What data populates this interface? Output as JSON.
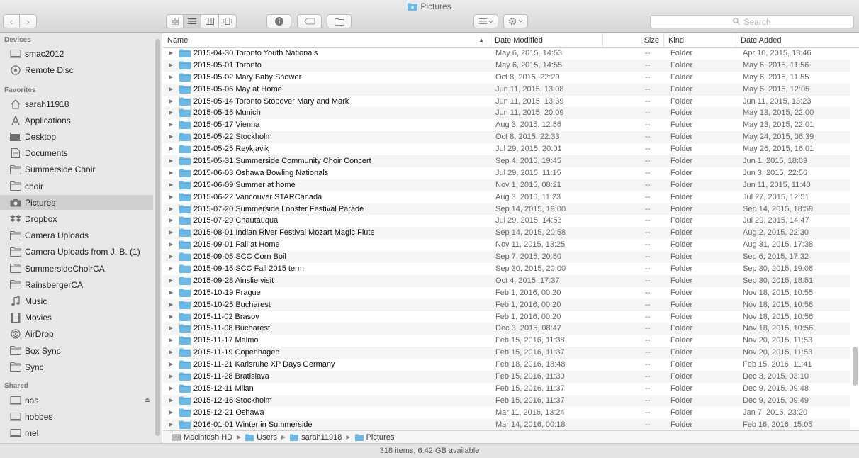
{
  "window": {
    "title": "Pictures"
  },
  "toolbar": {
    "search_placeholder": "Search"
  },
  "sidebar": {
    "devices_heading": "Devices",
    "devices": [
      {
        "label": "smac2012",
        "icon": "computer-icon"
      },
      {
        "label": "Remote Disc",
        "icon": "disc-icon"
      }
    ],
    "favorites_heading": "Favorites",
    "favorites": [
      {
        "label": "sarah11918",
        "icon": "home-icon"
      },
      {
        "label": "Applications",
        "icon": "applications-icon"
      },
      {
        "label": "Desktop",
        "icon": "desktop-icon"
      },
      {
        "label": "Documents",
        "icon": "document-icon"
      },
      {
        "label": "Summerside Choir",
        "icon": "folder-icon"
      },
      {
        "label": "choir",
        "icon": "folder-icon"
      },
      {
        "label": "Pictures",
        "icon": "camera-icon"
      },
      {
        "label": "Dropbox",
        "icon": "dropbox-icon"
      },
      {
        "label": "Camera Uploads",
        "icon": "folder-icon"
      },
      {
        "label": "Camera Uploads from J. B. (1)",
        "icon": "folder-icon"
      },
      {
        "label": "SummersideChoirCA",
        "icon": "folder-icon"
      },
      {
        "label": "RainsbergerCA",
        "icon": "folder-icon"
      },
      {
        "label": "Music",
        "icon": "music-icon"
      },
      {
        "label": "Movies",
        "icon": "movies-icon"
      },
      {
        "label": "AirDrop",
        "icon": "airdrop-icon"
      },
      {
        "label": "Box Sync",
        "icon": "folder-icon"
      },
      {
        "label": "Sync",
        "icon": "folder-icon"
      }
    ],
    "shared_heading": "Shared",
    "shared": [
      {
        "label": "nas",
        "icon": "server-icon"
      },
      {
        "label": "hobbes",
        "icon": "server-icon"
      },
      {
        "label": "mel",
        "icon": "server-icon"
      }
    ]
  },
  "columns": {
    "name": "Name",
    "date_modified": "Date Modified",
    "size": "Size",
    "kind": "Kind",
    "date_added": "Date Added"
  },
  "rows": [
    {
      "name": "2015-04-30 Toronto Youth Nationals",
      "modified": "May 6, 2015, 14:53",
      "size": "--",
      "kind": "Folder",
      "added": "Apr 10, 2015, 18:46"
    },
    {
      "name": "2015-05-01 Toronto",
      "modified": "May 6, 2015, 14:55",
      "size": "--",
      "kind": "Folder",
      "added": "May 6, 2015, 11:56"
    },
    {
      "name": "2015-05-02 Mary Baby Shower",
      "modified": "Oct 8, 2015, 22:29",
      "size": "--",
      "kind": "Folder",
      "added": "May 6, 2015, 11:55"
    },
    {
      "name": "2015-05-06 May at Home",
      "modified": "Jun 11, 2015, 13:08",
      "size": "--",
      "kind": "Folder",
      "added": "May 6, 2015, 12:05"
    },
    {
      "name": "2015-05-14 Toronto Stopover Mary and Mark",
      "modified": "Jun 11, 2015, 13:39",
      "size": "--",
      "kind": "Folder",
      "added": "Jun 11, 2015, 13:23"
    },
    {
      "name": "2015-05-16 Munich",
      "modified": "Jun 11, 2015, 20:09",
      "size": "--",
      "kind": "Folder",
      "added": "May 13, 2015, 22:00"
    },
    {
      "name": "2015-05-17 Vienna",
      "modified": "Aug 3, 2015, 12:56",
      "size": "--",
      "kind": "Folder",
      "added": "May 13, 2015, 22:01"
    },
    {
      "name": "2015-05-22 Stockholm",
      "modified": "Oct 8, 2015, 22:33",
      "size": "--",
      "kind": "Folder",
      "added": "May 24, 2015, 06:39"
    },
    {
      "name": "2015-05-25 Reykjavik",
      "modified": "Jul 29, 2015, 20:01",
      "size": "--",
      "kind": "Folder",
      "added": "May 26, 2015, 16:01"
    },
    {
      "name": "2015-05-31 Summerside Community Choir Concert",
      "modified": "Sep 4, 2015, 19:45",
      "size": "--",
      "kind": "Folder",
      "added": "Jun 1, 2015, 18:09"
    },
    {
      "name": "2015-06-03 Oshawa Bowling Nationals",
      "modified": "Jul 29, 2015, 11:15",
      "size": "--",
      "kind": "Folder",
      "added": "Jun 3, 2015, 22:56"
    },
    {
      "name": "2015-06-09 Summer at home",
      "modified": "Nov 1, 2015, 08:21",
      "size": "--",
      "kind": "Folder",
      "added": "Jun 11, 2015, 11:40"
    },
    {
      "name": "2015-06-22 Vancouver STARCanada",
      "modified": "Aug 3, 2015, 11:23",
      "size": "--",
      "kind": "Folder",
      "added": "Jul 27, 2015, 12:51"
    },
    {
      "name": "2015-07-20 Summerside Lobster Festival Parade",
      "modified": "Sep 14, 2015, 19:00",
      "size": "--",
      "kind": "Folder",
      "added": "Sep 14, 2015, 18:59"
    },
    {
      "name": "2015-07-29 Chautauqua",
      "modified": "Jul 29, 2015, 14:53",
      "size": "--",
      "kind": "Folder",
      "added": "Jul 29, 2015, 14:47"
    },
    {
      "name": "2015-08-01 Indian River Festival Mozart Magic Flute",
      "modified": "Sep 14, 2015, 20:58",
      "size": "--",
      "kind": "Folder",
      "added": "Aug 2, 2015, 22:30"
    },
    {
      "name": "2015-09-01 Fall at Home",
      "modified": "Nov 11, 2015, 13:25",
      "size": "--",
      "kind": "Folder",
      "added": "Aug 31, 2015, 17:38"
    },
    {
      "name": "2015-09-05 SCC Corn Boil",
      "modified": "Sep 7, 2015, 20:50",
      "size": "--",
      "kind": "Folder",
      "added": "Sep 6, 2015, 17:32"
    },
    {
      "name": "2015-09-15 SCC Fall 2015 term",
      "modified": "Sep 30, 2015, 20:00",
      "size": "--",
      "kind": "Folder",
      "added": "Sep 30, 2015, 19:08"
    },
    {
      "name": "2015-09-28 Ainslie visit",
      "modified": "Oct 4, 2015, 17:37",
      "size": "--",
      "kind": "Folder",
      "added": "Sep 30, 2015, 18:51"
    },
    {
      "name": "2015-10-19 Prague",
      "modified": "Feb 1, 2016, 00:20",
      "size": "--",
      "kind": "Folder",
      "added": "Nov 18, 2015, 10:55"
    },
    {
      "name": "2015-10-25 Bucharest",
      "modified": "Feb 1, 2016, 00:20",
      "size": "--",
      "kind": "Folder",
      "added": "Nov 18, 2015, 10:58"
    },
    {
      "name": "2015-11-02 Brasov",
      "modified": "Feb 1, 2016, 00:20",
      "size": "--",
      "kind": "Folder",
      "added": "Nov 18, 2015, 10:56"
    },
    {
      "name": "2015-11-08 Bucharest",
      "modified": "Dec 3, 2015, 08:47",
      "size": "--",
      "kind": "Folder",
      "added": "Nov 18, 2015, 10:56"
    },
    {
      "name": "2015-11-17 Malmo",
      "modified": "Feb 15, 2016, 11:38",
      "size": "--",
      "kind": "Folder",
      "added": "Nov 20, 2015, 11:53"
    },
    {
      "name": "2015-11-19 Copenhagen",
      "modified": "Feb 15, 2016, 11:37",
      "size": "--",
      "kind": "Folder",
      "added": "Nov 20, 2015, 11:53"
    },
    {
      "name": "2015-11-21 Karlsruhe XP Days Germany",
      "modified": "Feb 18, 2016, 18:48",
      "size": "--",
      "kind": "Folder",
      "added": "Feb 15, 2016, 11:41"
    },
    {
      "name": "2015-11-28 Bratislava",
      "modified": "Feb 15, 2016, 11:30",
      "size": "--",
      "kind": "Folder",
      "added": "Dec 3, 2015, 03:10"
    },
    {
      "name": "2015-12-11 Milan",
      "modified": "Feb 15, 2016, 11:37",
      "size": "--",
      "kind": "Folder",
      "added": "Dec 9, 2015, 09:48"
    },
    {
      "name": "2015-12-16 Stockholm",
      "modified": "Feb 15, 2016, 11:37",
      "size": "--",
      "kind": "Folder",
      "added": "Dec 9, 2015, 09:49"
    },
    {
      "name": "2015-12-21 Oshawa",
      "modified": "Mar 11, 2016, 13:24",
      "size": "--",
      "kind": "Folder",
      "added": "Jan 7, 2016, 23:20"
    },
    {
      "name": "2016-01-01 Winter in Summerside",
      "modified": "Mar 14, 2016, 00:18",
      "size": "--",
      "kind": "Folder",
      "added": "Feb 16, 2016, 15:05"
    }
  ],
  "pathbar": [
    "Macintosh HD",
    "Users",
    "sarah11918",
    "Pictures"
  ],
  "status": "318 items, 6.42 GB available",
  "colors": {
    "folder": "#6cb8e6",
    "selected_sidebar": "#cfcfcf",
    "accent": "#3d8fd6"
  }
}
